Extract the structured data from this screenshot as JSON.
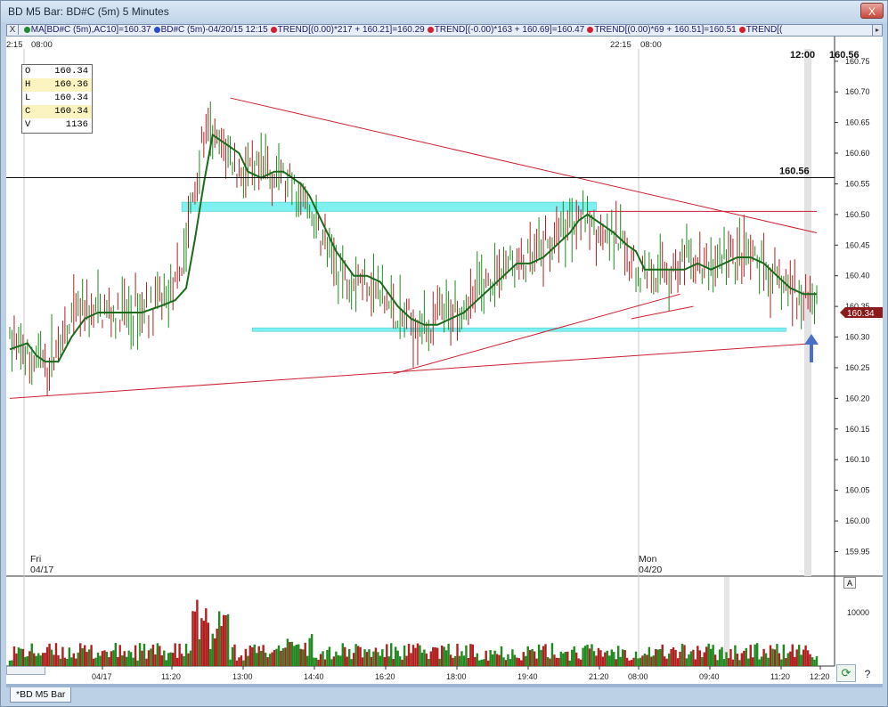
{
  "window": {
    "title": "BD M5 Bar: BD#C (5m) 5 Minutes",
    "close_label": "X",
    "tab_label": "*BD M5 Bar"
  },
  "studybar": {
    "close_label": "X",
    "items": [
      {
        "dot": "g",
        "text": "MA[BD#C (5m),AC10]=160.37"
      },
      {
        "dot": "b",
        "text": "BD#C (5m)-04/20/15 12:15"
      },
      {
        "dot": "r",
        "text": "TREND[(0.00)*217 + 160.21]=160.29"
      },
      {
        "dot": "r",
        "text": "TREND[(-0.00)*163 + 160.69]=160.47"
      },
      {
        "dot": "r",
        "text": "TREND[(0.00)*69 + 160.51]=160.51"
      },
      {
        "dot": "r",
        "text": "TREND[("
      }
    ]
  },
  "ohlc": {
    "o_label": "O",
    "o": "160.34",
    "h_label": "H",
    "h": "160.36",
    "l_label": "L",
    "l": "160.34",
    "c_label": "C",
    "c": "160.34",
    "v_label": "V",
    "v": "1136"
  },
  "top_time_labels": {
    "left_a": "2:15",
    "left_b": "08:00",
    "mid_a": "22:15",
    "mid_b": "08:00"
  },
  "cursor": {
    "time": "12:00",
    "price": "160.56"
  },
  "hline_label": "160.56",
  "last_price_tag": "160.34",
  "day_labels": [
    {
      "day": "Fri",
      "date": "04/17"
    },
    {
      "day": "Mon",
      "date": "04/20"
    }
  ],
  "volume_axis_label": "10000",
  "volume_button_label": "A",
  "refresh_icon": "refresh-icon",
  "help_label": "?",
  "colors": {
    "bar_up": "#1f8a1f",
    "bar_down": "#b11f1f",
    "ma": "#1a6b1a",
    "trend": "#cc2030",
    "zone": "#7ff0f0",
    "arrow": "#4b6fc8"
  },
  "chart_data": {
    "type": "bar",
    "symbol": "BD#C (5m)",
    "interval": "5 Minutes",
    "price_axis": {
      "ylim": [
        159.91,
        160.77
      ],
      "ticks": [
        "160.75",
        "160.70",
        "160.65",
        "160.60",
        "160.55",
        "160.50",
        "160.45",
        "160.40",
        "160.35",
        "160.30",
        "160.25",
        "160.20",
        "160.15",
        "160.10",
        "160.05",
        "160.00",
        "159.95"
      ]
    },
    "time_axis_ticks": [
      "04/17",
      "11:20",
      "13:00",
      "14:40",
      "16:20",
      "18:00",
      "19:40",
      "21:20",
      "08:00",
      "09:40",
      "11:20",
      "12:20"
    ],
    "moving_average_path": [
      [
        0,
        160.28
      ],
      [
        8,
        160.29
      ],
      [
        12,
        160.27
      ],
      [
        16,
        160.26
      ],
      [
        22,
        160.26
      ],
      [
        28,
        160.3
      ],
      [
        34,
        160.33
      ],
      [
        40,
        160.34
      ],
      [
        50,
        160.34
      ],
      [
        60,
        160.34
      ],
      [
        68,
        160.35
      ],
      [
        75,
        160.36
      ],
      [
        80,
        160.38
      ],
      [
        84,
        160.46
      ],
      [
        88,
        160.55
      ],
      [
        92,
        160.63
      ],
      [
        96,
        160.62
      ],
      [
        100,
        160.61
      ],
      [
        104,
        160.6
      ],
      [
        108,
        160.57
      ],
      [
        114,
        160.56
      ],
      [
        120,
        160.57
      ],
      [
        124,
        160.57
      ],
      [
        128,
        160.56
      ],
      [
        132,
        160.55
      ],
      [
        136,
        160.53
      ],
      [
        140,
        160.5
      ],
      [
        144,
        160.47
      ],
      [
        148,
        160.44
      ],
      [
        152,
        160.42
      ],
      [
        156,
        160.4
      ],
      [
        162,
        160.4
      ],
      [
        168,
        160.39
      ],
      [
        172,
        160.37
      ],
      [
        176,
        160.35
      ],
      [
        182,
        160.33
      ],
      [
        188,
        160.32
      ],
      [
        194,
        160.32
      ],
      [
        200,
        160.33
      ],
      [
        206,
        160.34
      ],
      [
        212,
        160.36
      ],
      [
        218,
        160.38
      ],
      [
        224,
        160.4
      ],
      [
        230,
        160.42
      ],
      [
        236,
        160.42
      ],
      [
        242,
        160.43
      ],
      [
        248,
        160.45
      ],
      [
        254,
        160.47
      ],
      [
        258,
        160.49
      ],
      [
        262,
        160.5
      ],
      [
        266,
        160.49
      ],
      [
        270,
        160.48
      ],
      [
        274,
        160.47
      ],
      [
        280,
        160.45
      ],
      [
        284,
        160.44
      ],
      [
        288,
        160.41
      ],
      [
        294,
        160.41
      ],
      [
        300,
        160.41
      ],
      [
        306,
        160.41
      ],
      [
        312,
        160.42
      ],
      [
        318,
        160.41
      ],
      [
        324,
        160.42
      ],
      [
        330,
        160.43
      ],
      [
        336,
        160.43
      ],
      [
        342,
        160.42
      ],
      [
        348,
        160.4
      ],
      [
        354,
        160.38
      ],
      [
        360,
        160.37
      ],
      [
        366,
        160.37
      ]
    ],
    "trendlines": [
      {
        "from": [
          0,
          160.2
        ],
        "to": [
          366,
          160.29
        ]
      },
      {
        "from": [
          174,
          160.24
        ],
        "to": [
          304,
          160.37
        ]
      },
      {
        "from": [
          100,
          160.69
        ],
        "to": [
          366,
          160.47
        ]
      },
      {
        "from": [
          262,
          160.505
        ],
        "to": [
          366,
          160.505
        ]
      },
      {
        "from": [
          282,
          160.33
        ],
        "to": [
          310,
          160.35
        ]
      }
    ],
    "zones": [
      {
        "from": 78,
        "to": 266,
        "y": [
          160.505,
          160.52
        ]
      },
      {
        "from": 110,
        "to": 352,
        "y": [
          160.31,
          160.315
        ]
      }
    ],
    "horizontal_line": 160.56,
    "volume": {
      "ylabel_tick": 10000
    }
  }
}
